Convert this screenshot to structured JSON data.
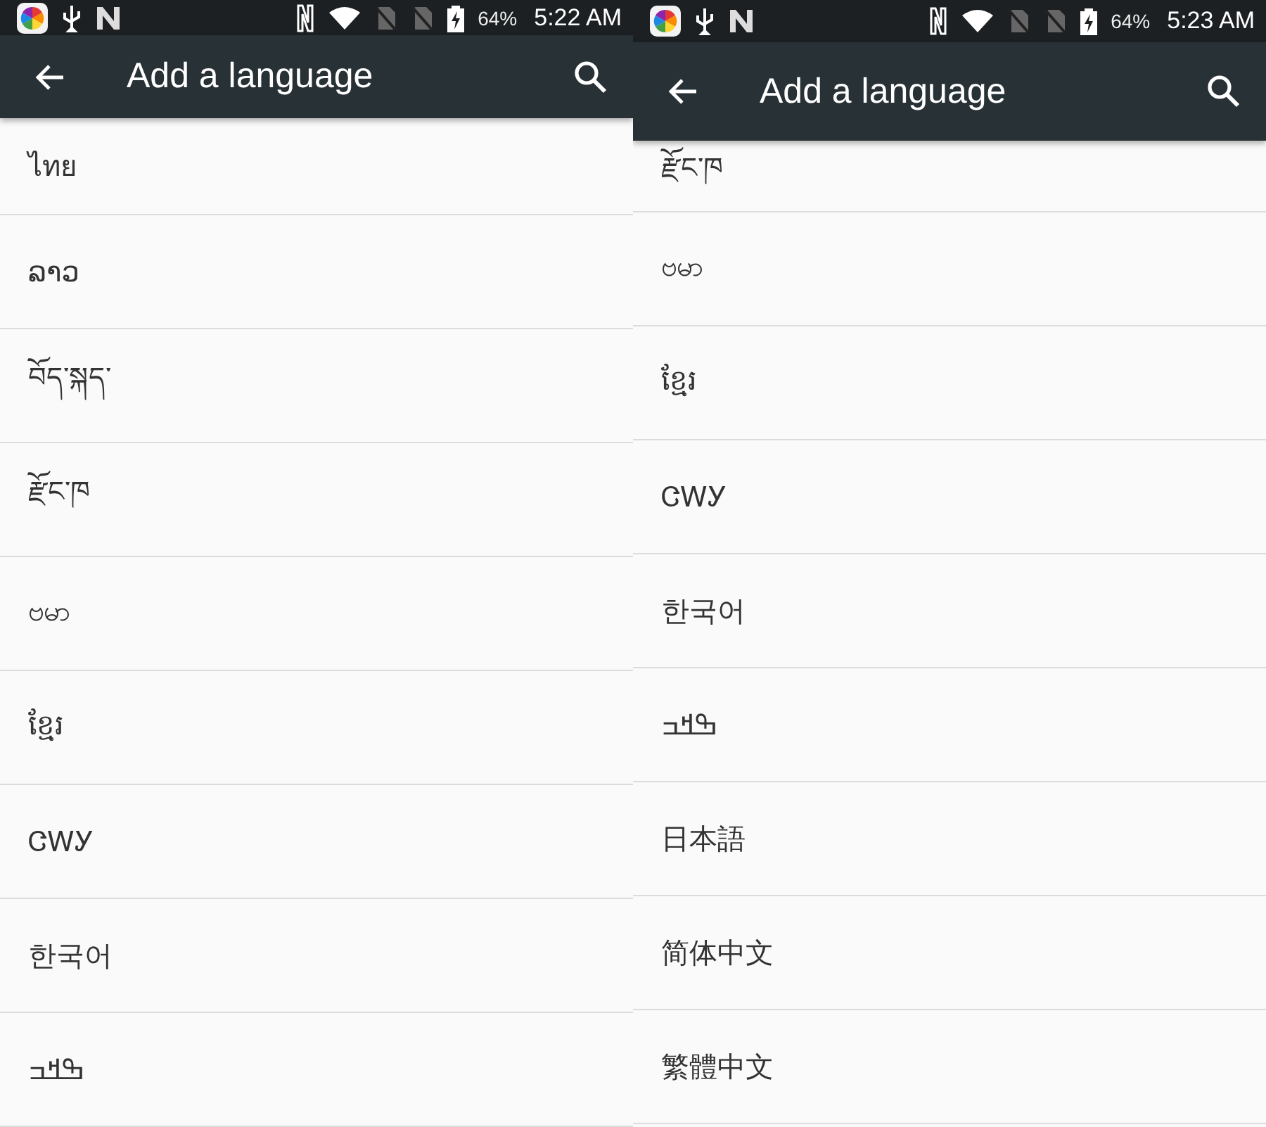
{
  "screens": [
    {
      "status_bar": {
        "battery": "64%",
        "time": "5:22 AM"
      },
      "title": "Add a language",
      "languages": [
        "ไทย",
        "ລາວ",
        "བོད་སྐད་",
        "རྫོང་ཁ",
        "ဗမာ",
        "ខ្មែរ",
        "ᏣᎳᎩ",
        "한국어",
        "ߒߞߏ"
      ]
    },
    {
      "status_bar": {
        "battery": "64%",
        "time": "5:23 AM"
      },
      "title": "Add a language",
      "languages": [
        "རྫོང་ཁ",
        "ဗမာ",
        "ខ្មែរ",
        "ᏣᎳᎩ",
        "한국어",
        "ߒߞߏ",
        "日本語",
        "简体中文",
        "繁體中文"
      ]
    }
  ]
}
